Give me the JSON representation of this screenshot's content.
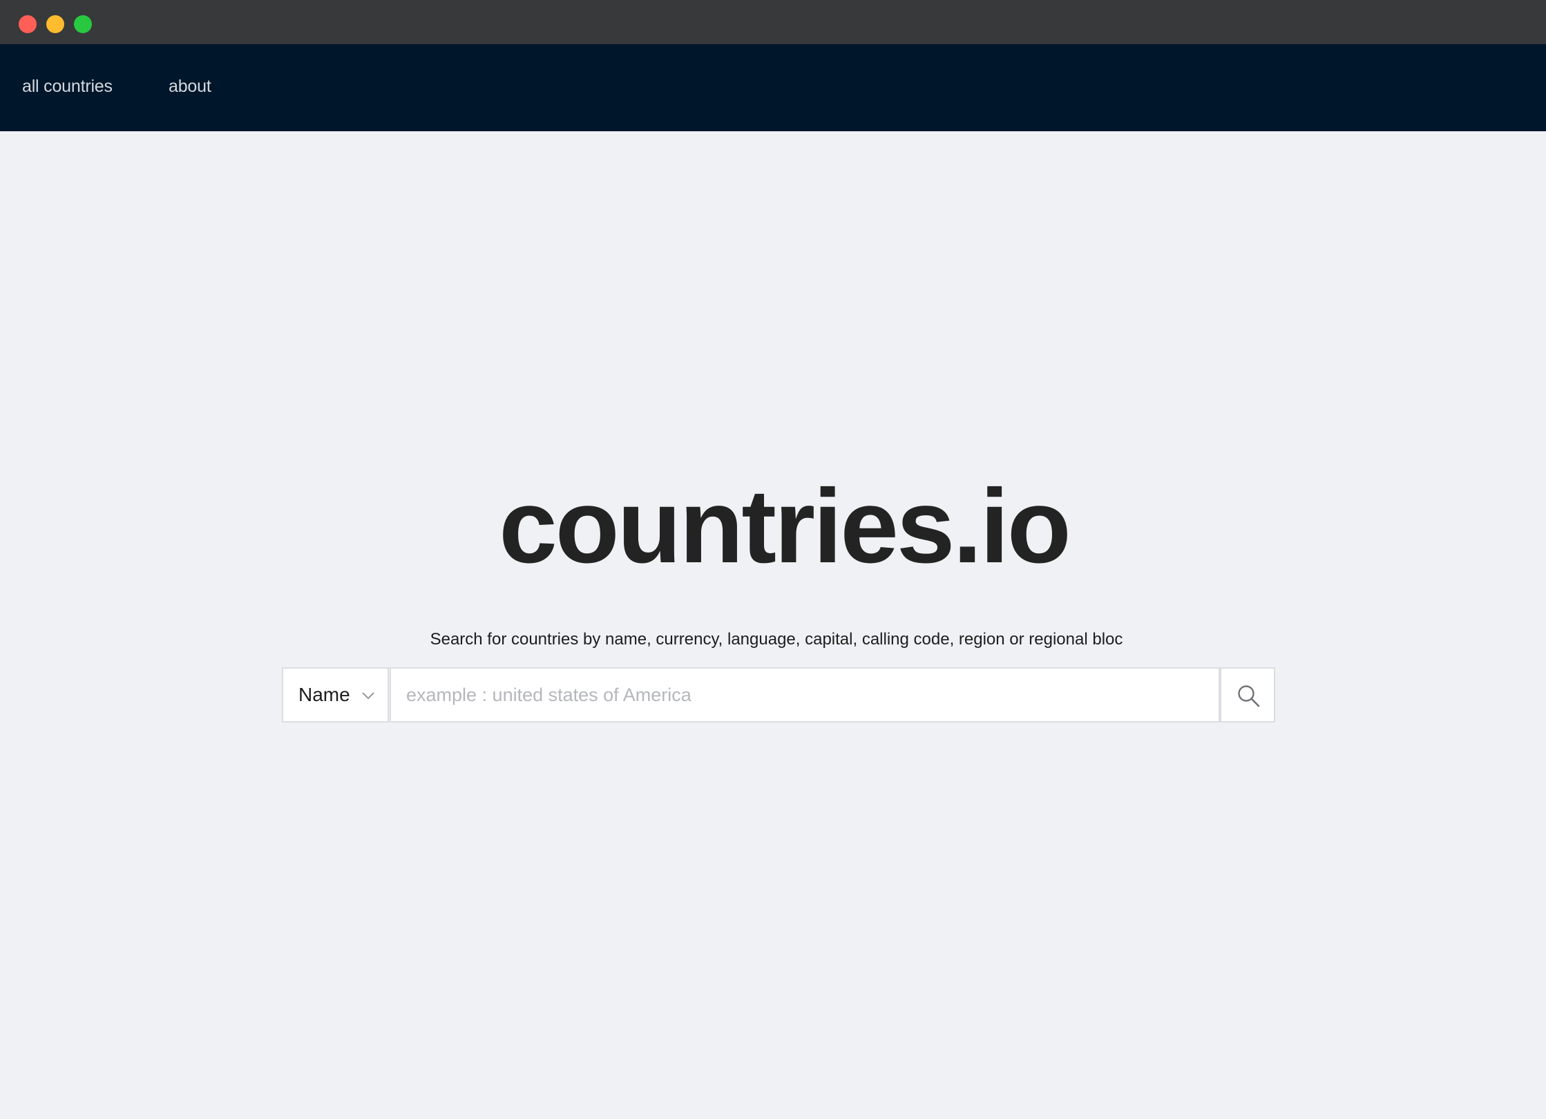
{
  "nav": {
    "links": [
      {
        "label": "all countries"
      },
      {
        "label": "about"
      }
    ]
  },
  "hero": {
    "logo": "countries.io",
    "tagline": "Search for countries by name, currency, language, capital, calling code, region or regional bloc"
  },
  "search": {
    "field_selected": "Name",
    "placeholder": "example : united states of America",
    "value": "",
    "button_icon": "search-icon"
  },
  "colors": {
    "titlebar": "#38393b",
    "navbar": "#00162a",
    "page_background": "#f0f1f5",
    "logo_text": "#232323"
  }
}
